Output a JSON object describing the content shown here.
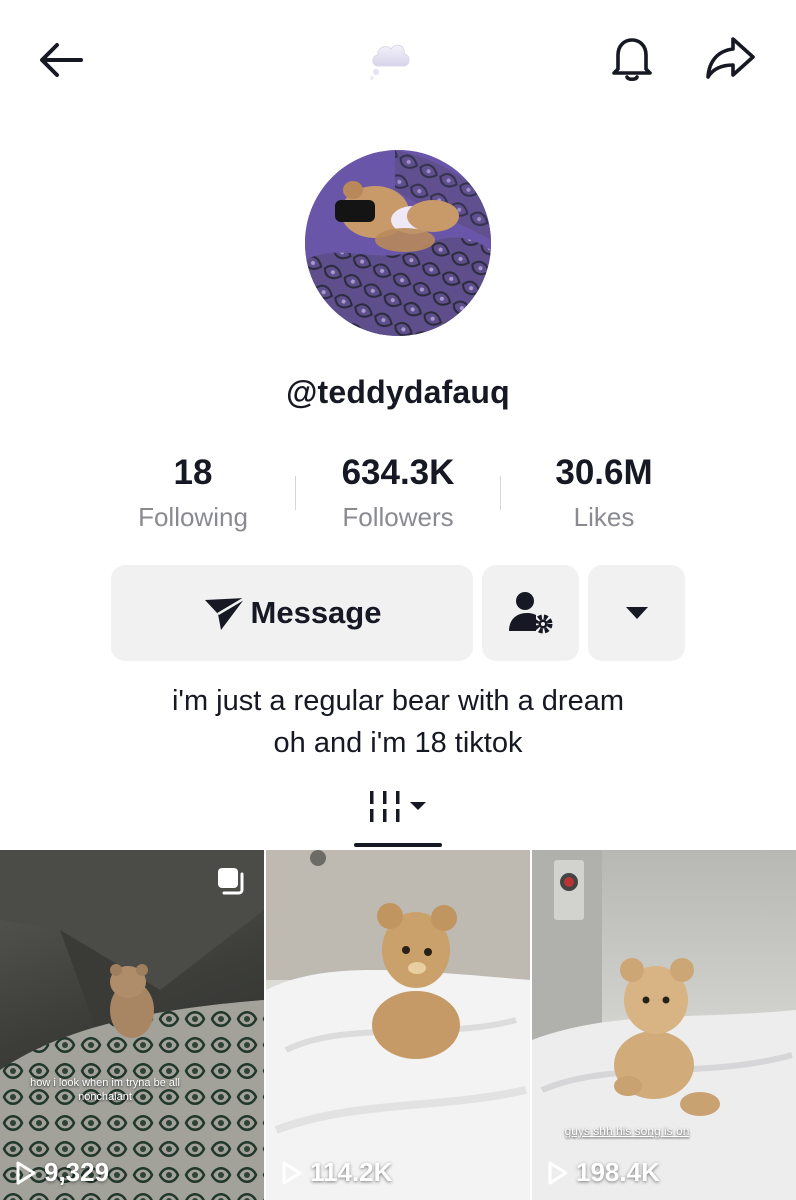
{
  "header": {
    "back_icon": "arrow-left-icon",
    "center_icon": "cloud-icon",
    "bell_icon": "bell-icon",
    "share_icon": "share-arrow-icon"
  },
  "profile": {
    "username": "@teddydafauq",
    "bio_line1": "i'm just a regular bear with a dream",
    "bio_line2": "oh and i'm 18 tiktok"
  },
  "stats": [
    {
      "value": "18",
      "label": "Following"
    },
    {
      "value": "634.3K",
      "label": "Followers"
    },
    {
      "value": "30.6M",
      "label": "Likes"
    }
  ],
  "actions": {
    "message_label": "Message",
    "message_icon": "paper-plane-icon",
    "friend_icon": "user-settings-icon",
    "more_icon": "caret-down-icon"
  },
  "tabs": {
    "grid_icon": "grid-columns-icon"
  },
  "videos": [
    {
      "views": "9,329",
      "caption": "how i look when im tryna be all nonchalant",
      "multi": true
    },
    {
      "views": "114.2K",
      "caption": ""
    },
    {
      "views": "198.4K",
      "caption": "guys shh his song is on"
    }
  ],
  "colors": {
    "text": "#161823",
    "muted": "#8a8b91",
    "button_bg": "#f1f1f2"
  }
}
